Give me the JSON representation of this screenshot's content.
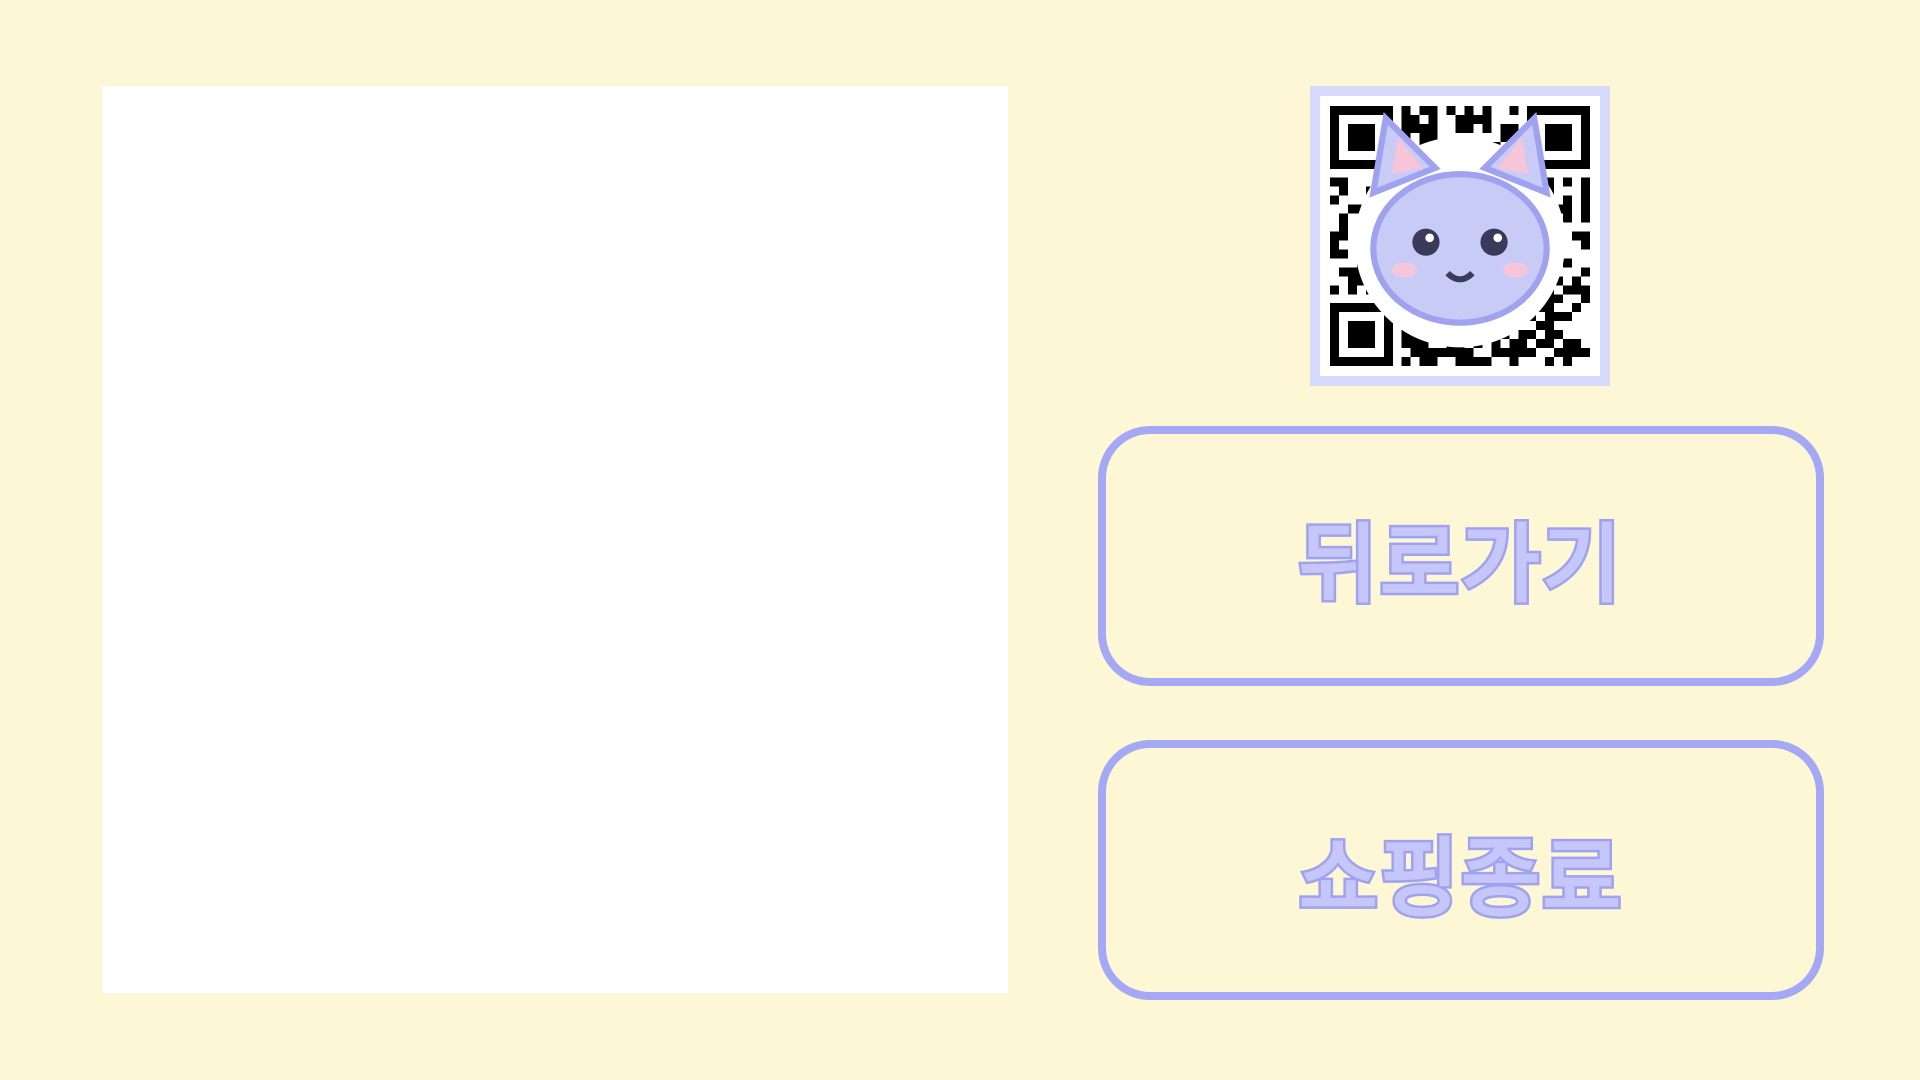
{
  "qr": {
    "icon": "qr-code-icon",
    "logo_icon": "cat-face-icon"
  },
  "buttons": {
    "back_label": "뒤로가기",
    "end_shopping_label": "쇼핑종료"
  },
  "colors": {
    "background": "#fdf7d6",
    "accent": "#a5a8f4",
    "qr_frame": "#d7d9fd",
    "label_fill": "#c5c7fb"
  }
}
